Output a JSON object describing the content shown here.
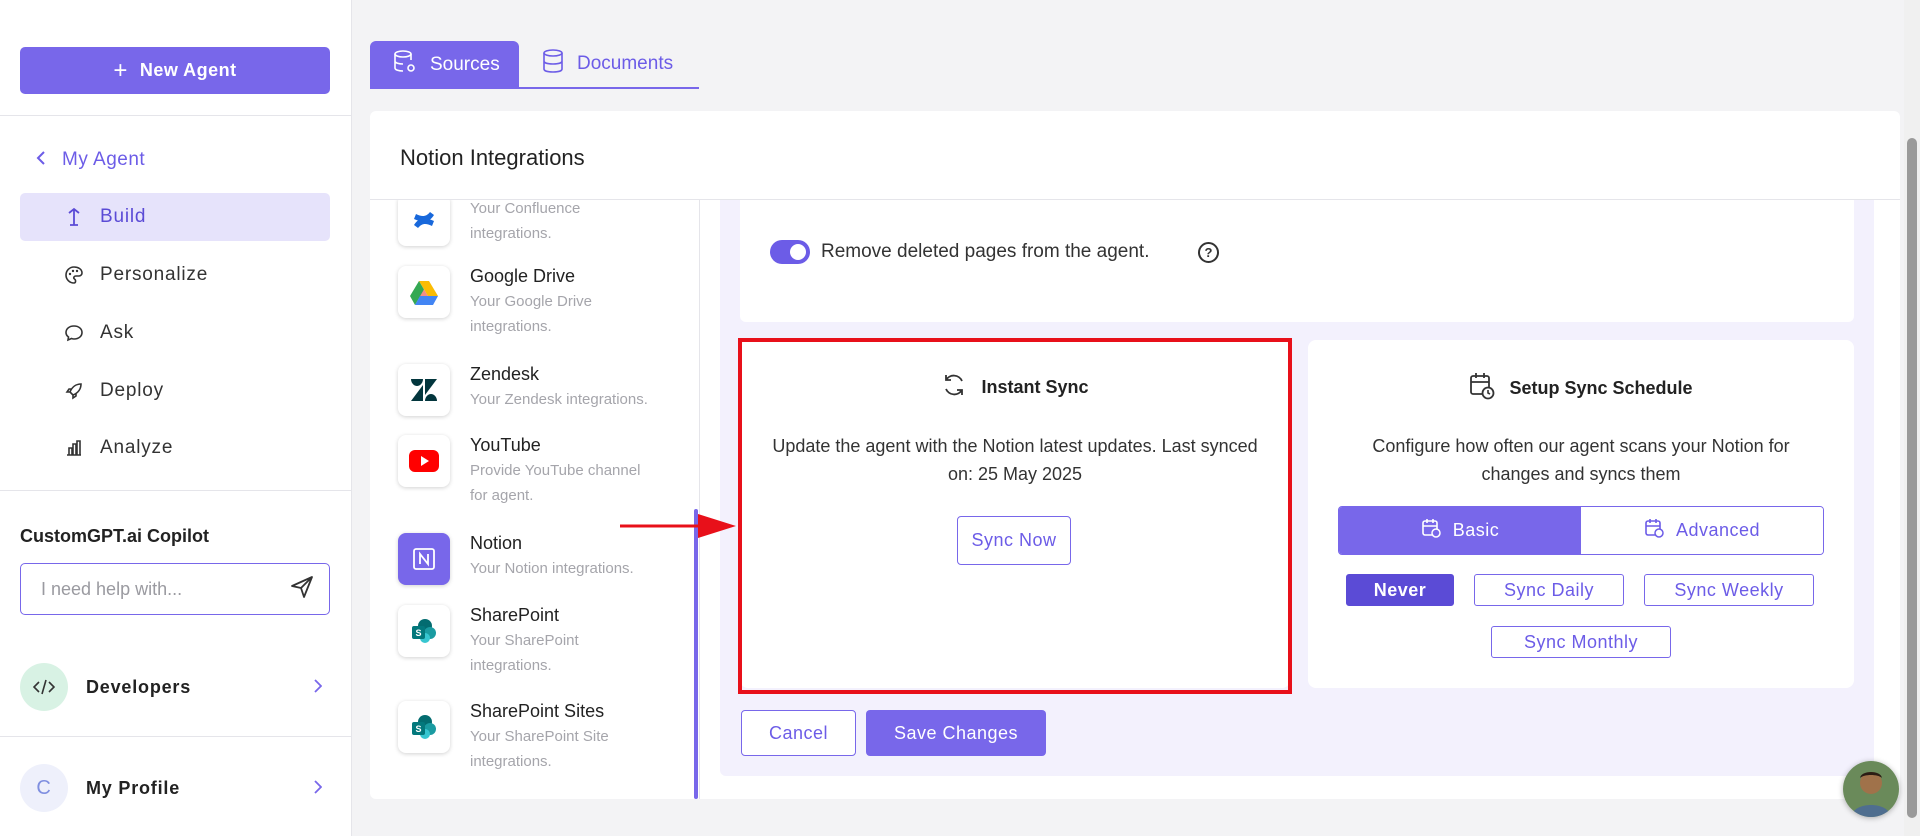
{
  "sidebar": {
    "new_agent_label": "New Agent",
    "my_agent_label": "My Agent",
    "nav": [
      {
        "label": "Build",
        "icon": "build-icon",
        "active": true
      },
      {
        "label": "Personalize",
        "icon": "palette-icon"
      },
      {
        "label": "Ask",
        "icon": "chat-icon"
      },
      {
        "label": "Deploy",
        "icon": "rocket-icon"
      },
      {
        "label": "Analyze",
        "icon": "chart-icon"
      }
    ],
    "copilot_title": "CustomGPT.ai Copilot",
    "copilot_placeholder": "I need help with...",
    "developers_label": "Developers",
    "profile_label": "My Profile",
    "profile_initial": "C"
  },
  "tabs": [
    {
      "label": "Sources",
      "icon": "database-settings-icon",
      "active": true
    },
    {
      "label": "Documents",
      "icon": "database-icon",
      "active": false
    }
  ],
  "panel": {
    "title": "Notion Integrations",
    "integrations": [
      {
        "name": "",
        "desc": "Your Confluence integrations.",
        "icon": "confluence-icon"
      },
      {
        "name": "Google Drive",
        "desc": "Your Google Drive integrations.",
        "icon": "google-drive-icon"
      },
      {
        "name": "Zendesk",
        "desc": "Your Zendesk integrations.",
        "icon": "zendesk-icon"
      },
      {
        "name": "YouTube",
        "desc": "Provide YouTube channel for agent.",
        "icon": "youtube-icon"
      },
      {
        "name": "Notion",
        "desc": "Your Notion integrations.",
        "icon": "notion-icon",
        "selected": true
      },
      {
        "name": "SharePoint",
        "desc": "Your SharePoint integrations.",
        "icon": "sharepoint-icon"
      },
      {
        "name": "SharePoint Sites",
        "desc": "Your SharePoint Site integrations.",
        "icon": "sharepoint-icon"
      }
    ],
    "toggle_label": "Remove deleted pages from the agent.",
    "toggle_on": true,
    "instant_sync": {
      "title": "Instant Sync",
      "body": "Update the agent with the Notion latest updates. Last synced on: 25 May 2025",
      "button": "Sync Now"
    },
    "schedule": {
      "title": "Setup Sync Schedule",
      "body": "Configure how often our agent scans your Notion for changes and syncs them",
      "mode_basic": "Basic",
      "mode_advanced": "Advanced",
      "options": [
        "Never",
        "Sync Daily",
        "Sync Weekly",
        "Sync Monthly"
      ],
      "selected": "Never"
    },
    "cancel_label": "Cancel",
    "save_label": "Save Changes"
  },
  "colors": {
    "accent": "#7867ea",
    "highlight": "#e8101a"
  }
}
